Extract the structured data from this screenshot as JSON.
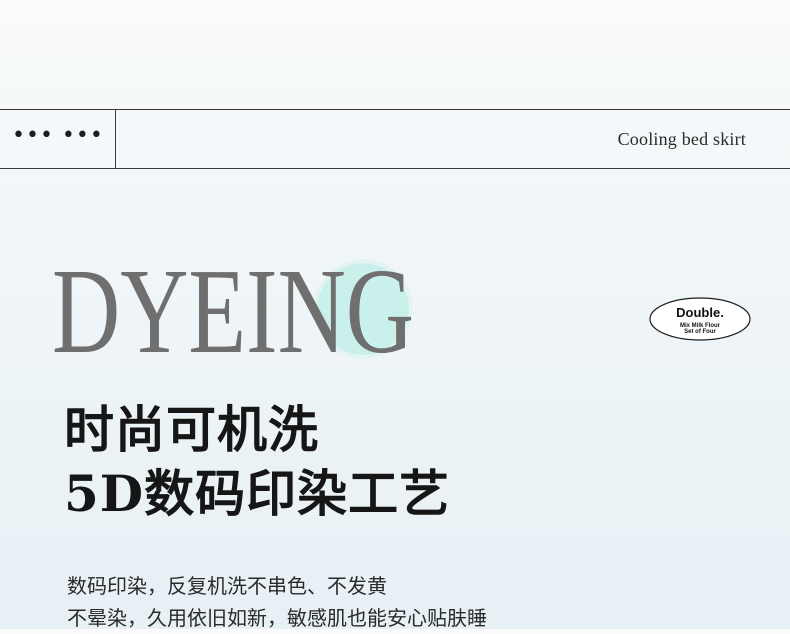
{
  "header_band": {
    "dots": "••• •••",
    "title": "Cooling bed skirt"
  },
  "feature_word": {
    "text": "DYEING",
    "accent_color": "#c7efea",
    "text_color": "#6f6f6f"
  },
  "badge": {
    "title": "Double.",
    "line1": "Mix Milk Flour",
    "line2": "Set of Four"
  },
  "headline": {
    "line1": "时尚可机洗",
    "line2": "5D数码印染工艺"
  },
  "description": {
    "line1": "数码印染，反复机洗不串色、不发黄",
    "line2": "不晕染，久用依旧如新，敏感肌也能安心贴肤睡"
  }
}
